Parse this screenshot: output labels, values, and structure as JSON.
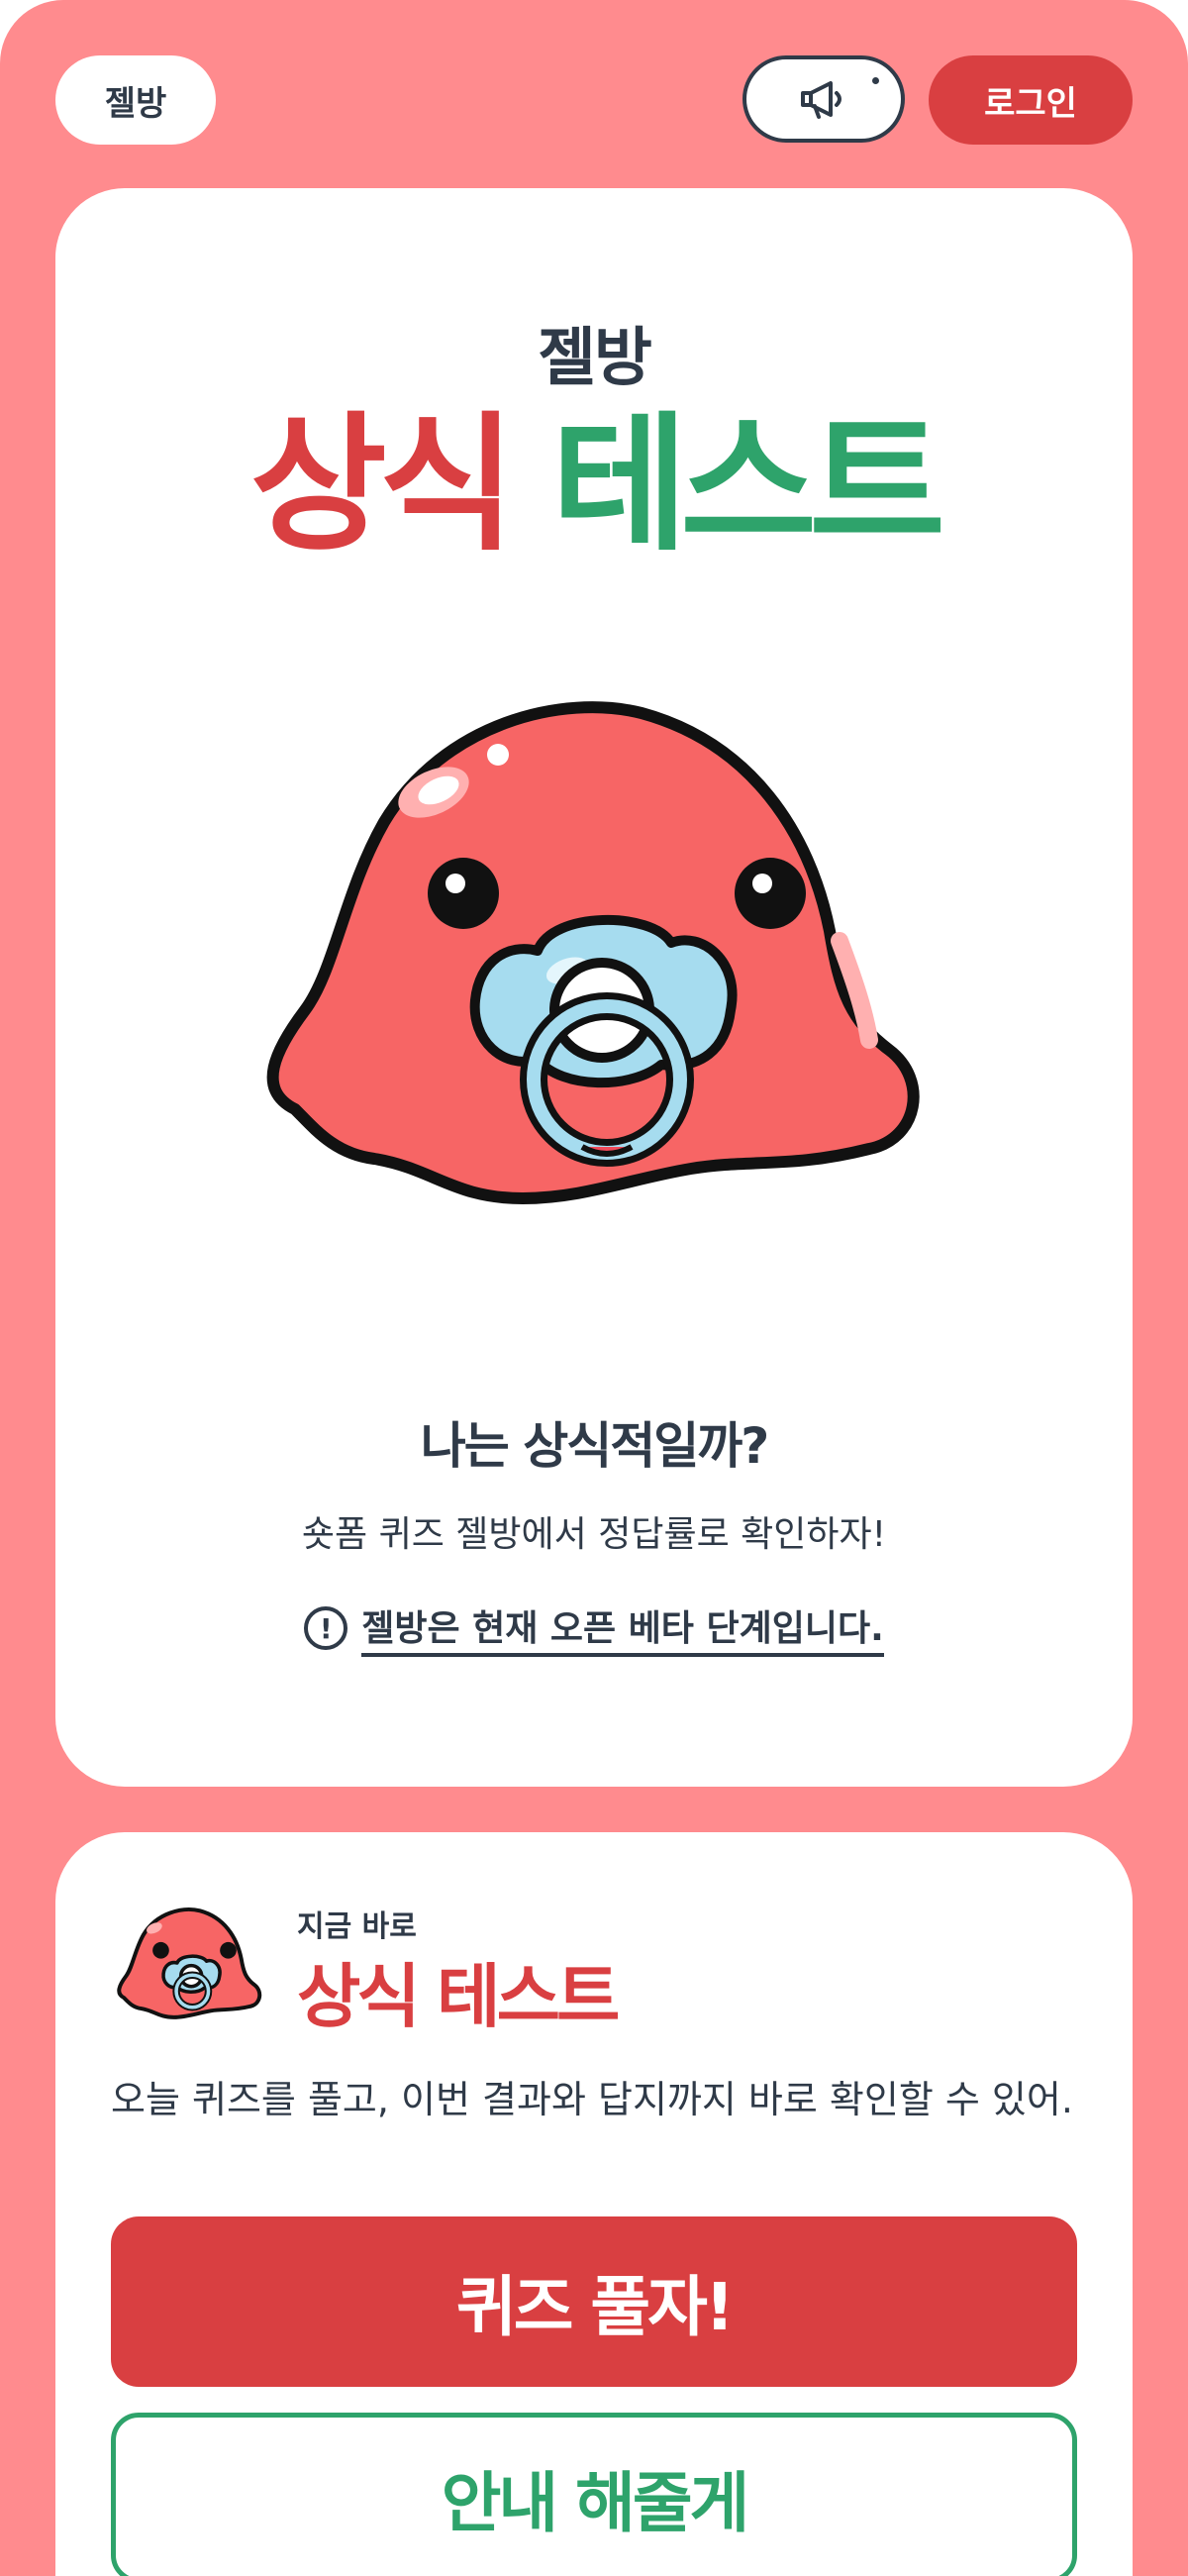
{
  "header": {
    "logo_label": "젤방",
    "notice_icon": "megaphone-icon",
    "login_label": "로그인"
  },
  "hero": {
    "subtitle": "젤방",
    "title_red": "상식",
    "title_green": "테스트",
    "question": "나는 상식적일까?",
    "tagline": "숏폼 퀴즈 젤방에서 정답률로 확인하자!",
    "beta_icon": "exclamation-circle-icon",
    "beta_notice": "젤방은 현재 오픈 베타 단계입니다."
  },
  "quiz_card": {
    "kicker": "지금 바로",
    "title": "상식 테스트",
    "description": "오늘 퀴즈를 풀고, 이번 결과와 답지까지 바로 확인할 수 있어.",
    "primary_button": "퀴즈 풀자!",
    "secondary_button": "안내 해줄게"
  },
  "colors": {
    "background": "#ff8b8e",
    "accent_red": "#d93f41",
    "accent_green": "#2ea36b",
    "text_dark": "#2f3a48",
    "mascot_body": "#f76565",
    "pacifier": "#a6dcef"
  }
}
